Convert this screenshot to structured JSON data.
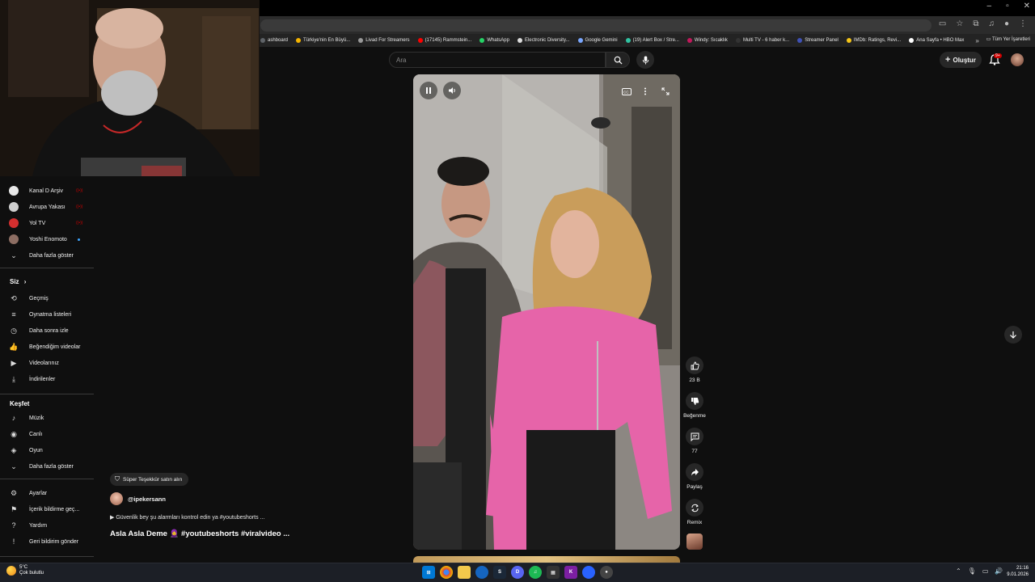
{
  "browser": {
    "bookmarks": [
      {
        "label": "ashboard",
        "color": "#5f6368"
      },
      {
        "label": "Türkiye'nin En Büyü...",
        "color": "#f5b400"
      },
      {
        "label": "Livad For Streamers",
        "color": "#9a9a9a"
      },
      {
        "label": "(17145) Rammstein...",
        "color": "#ff0000"
      },
      {
        "label": "WhatsApp",
        "color": "#25d366"
      },
      {
        "label": "Electronic Diversity...",
        "color": "#dddddd"
      },
      {
        "label": "Google Gemini",
        "color": "#7aa7ff"
      },
      {
        "label": "(19) Alert Box / Stre...",
        "color": "#31c3a2"
      },
      {
        "label": "Windy: Sıcaklık",
        "color": "#c2185b"
      },
      {
        "label": "Multi TV - 6 haber k...",
        "color": "#333333"
      },
      {
        "label": "Streamer Panel",
        "color": "#3f51b5"
      },
      {
        "label": "IMDb: Ratings, Revi...",
        "color": "#f5c518"
      },
      {
        "label": "Ana Sayfa • HBO Max",
        "color": "#ffffff"
      }
    ],
    "all_bookmarks_label": "Tüm Yer İşaretleri"
  },
  "youtube": {
    "search_placeholder": "Ara",
    "create_label": "Oluştur",
    "notification_badge": "9+"
  },
  "sidebar": {
    "subscriptions": [
      {
        "label": "Kanal D Arşiv",
        "live": true,
        "avatar_color": "#e8e8e8"
      },
      {
        "label": "Avrupa Yakası",
        "live": true,
        "avatar_color": "#cfcfcf"
      },
      {
        "label": "Yol TV",
        "live": true,
        "avatar_color": "#d32f2f"
      },
      {
        "label": "Yoshi Enomoto",
        "live": false,
        "avatar_color": "#8d6e63"
      }
    ],
    "more_label": "Daha fazla göster",
    "you_header": "Siz",
    "you_items": [
      {
        "label": "Geçmiş",
        "icon": "history-icon",
        "glyph": "⟲"
      },
      {
        "label": "Oynatma listeleri",
        "icon": "playlists-icon",
        "glyph": "≡"
      },
      {
        "label": "Daha sonra izle",
        "icon": "clock-icon",
        "glyph": "◷"
      },
      {
        "label": "Beğendiğim videolar",
        "icon": "thumb-up-icon",
        "glyph": "👍"
      },
      {
        "label": "Videolarınız",
        "icon": "your-videos-icon",
        "glyph": "▶"
      },
      {
        "label": "İndirilenler",
        "icon": "download-icon",
        "glyph": "⤓"
      }
    ],
    "explore_header": "Keşfet",
    "explore_items": [
      {
        "label": "Müzik",
        "icon": "music-icon",
        "glyph": "♪"
      },
      {
        "label": "Canlı",
        "icon": "live-icon",
        "glyph": "◉"
      },
      {
        "label": "Oyun",
        "icon": "gaming-icon",
        "glyph": "◈"
      }
    ],
    "explore_more_label": "Daha fazla göster",
    "bottom_items": [
      {
        "label": "Ayarlar",
        "icon": "gear-icon",
        "glyph": "⚙"
      },
      {
        "label": "İçerik bildirme geç...",
        "icon": "flag-icon",
        "glyph": "⚑"
      },
      {
        "label": "Yardım",
        "icon": "help-icon",
        "glyph": "?"
      },
      {
        "label": "Geri bildirim gönder",
        "icon": "feedback-icon",
        "glyph": "!"
      }
    ]
  },
  "short": {
    "thanks_label": "Süper Teşekkür satın alın",
    "channel": "@ipekersann",
    "description": "▶ Güvenlik bey şu alarmları kontrol edin ya #youtubeshorts ...",
    "title": "Asla Asla Deme 🧕 #youtubeshorts #viralvideo ...",
    "likes": "23 B",
    "dislike_label": "Beğenme",
    "comments": "77",
    "share_label": "Paylaş",
    "remix_label": "Remix"
  },
  "taskbar": {
    "temperature": "5°C",
    "weather": "Çok bulutlu",
    "time": "21:16",
    "date": "9.01.2026"
  }
}
